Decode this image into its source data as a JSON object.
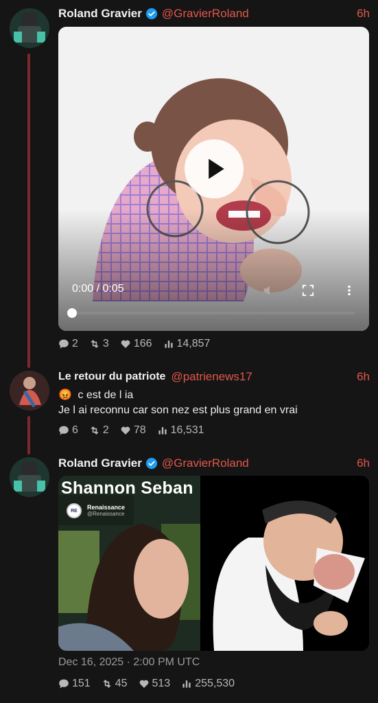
{
  "posts": [
    {
      "author": "Roland Gravier",
      "handle": "@GravierRoland",
      "time": "6h",
      "verified": true,
      "video": {
        "time_display": "0:00 / 0:05",
        "progress": 0.0
      },
      "stats": {
        "replies": "2",
        "reposts": "3",
        "likes": "166",
        "views": "14,857"
      }
    },
    {
      "author": "Le retour du patriote",
      "handle": "@patrienews17",
      "time": "6h",
      "verified": false,
      "text_line1": "c est de l ia",
      "emoji": "😡",
      "text_line2": "Je l ai reconnu car son nez est plus grand en vrai",
      "stats": {
        "replies": "6",
        "reposts": "2",
        "likes": "78",
        "views": "16,531"
      }
    },
    {
      "author": "Roland Gravier",
      "handle": "@GravierRoland",
      "time": "6h",
      "verified": true,
      "image": {
        "caption": "Shannon Seban",
        "embed_account": "Renaissance",
        "embed_handle": "@Renaissance",
        "embed_logo": "RE"
      },
      "date": "Dec 16, 2025 · 2:00 PM UTC",
      "stats": {
        "replies": "151",
        "reposts": "45",
        "likes": "513",
        "views": "255,530"
      }
    }
  ],
  "icons": {
    "reply": "comment-icon",
    "repost": "repost-icon",
    "like": "heart-icon",
    "views": "views-chart-icon",
    "play": "play-icon",
    "fullscreen": "fullscreen-icon",
    "more": "more-vertical-icon",
    "verified": "verified-badge-icon"
  },
  "colors": {
    "background": "#151515",
    "accent": "#e2574a",
    "thread": "#7a2a2a",
    "verified": "#1d9bf0"
  }
}
